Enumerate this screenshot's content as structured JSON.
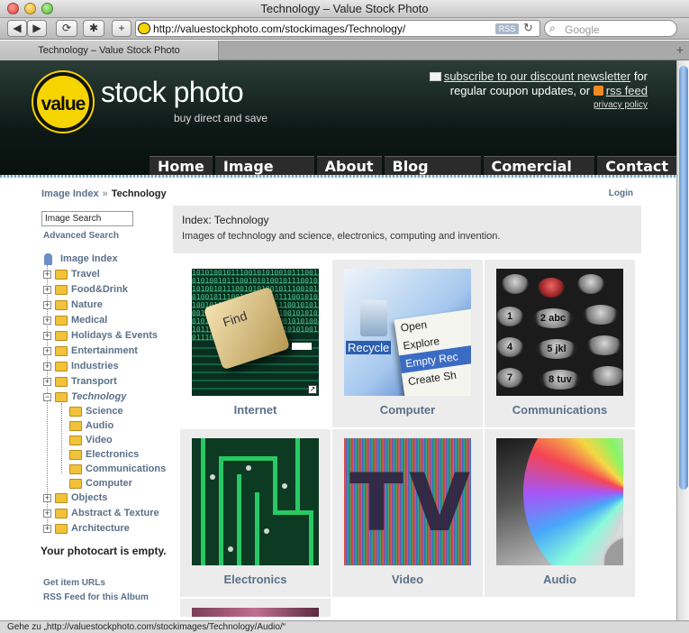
{
  "window": {
    "title": "Technology – Value Stock Photo"
  },
  "toolbar": {
    "url": "http://valuestockphoto.com/stockimages/Technology/",
    "rss_badge": "RSS",
    "search_placeholder": "Google",
    "back_glyph": "◀",
    "forward_glyph": "▶",
    "add_glyph": "+"
  },
  "tab": {
    "label": "Technology – Value Stock Photo"
  },
  "site": {
    "logo_badge": "value",
    "logo_name": "stock photo",
    "tagline": "buy direct and save",
    "newsletter_link": "subscribe to our discount newsletter",
    "newsletter_for": "for",
    "coupon_text": "regular coupon updates, or",
    "rss_link": "rss feed",
    "privacy": "privacy policy",
    "nav": [
      "Home",
      "Image Index",
      "About",
      "Blog Photos",
      "Comercial Use",
      "Contact"
    ]
  },
  "breadcrumb": {
    "parent": "Image Index",
    "sep": "»",
    "current": "Technology"
  },
  "login": "Login",
  "sidebar": {
    "search_value": "Image Search",
    "advanced": "Advanced Search",
    "root": "Image Index",
    "categories": [
      "Travel",
      "Food&Drink",
      "Nature",
      "Medical",
      "Holidays & Events",
      "Entertainment",
      "Industries",
      "Transport"
    ],
    "active": "Technology",
    "subcategories": [
      "Science",
      "Audio",
      "Video",
      "Electronics",
      "Communications",
      "Computer"
    ],
    "after": [
      "Objects",
      "Abstract & Texture",
      "Architecture"
    ],
    "cart": "Your photocart is empty.",
    "item_urls": "Get item URLs",
    "rss_album": "RSS Feed for this Album"
  },
  "index": {
    "title": "Index: Technology",
    "description": "Images of technology and science, electronics, computing and invention."
  },
  "thumbs": [
    "Internet",
    "Computer",
    "Communications",
    "Electronics",
    "Video",
    "Audio"
  ],
  "thumb_text": {
    "key": "Find",
    "menu": [
      "Open",
      "Explore",
      "Empty Rec",
      "Create Sh"
    ],
    "recycle": "Recycle",
    "keys": [
      "1",
      "2 abc",
      "4",
      "5 jkl",
      "7",
      "8 tuv"
    ],
    "tv": "TV",
    "digits": "1010100101110010101001011100101010010111001010100101110010101001011100101010010111001010100101110010101001011100101010010111001010100101110010101001011100101010010111001010100101110010101001011100101010010111001010100101110010101001011100"
  },
  "status": "Gehe zu „http://valuestockphoto.com/stockimages/Technology/Audio/“",
  "colors": {
    "link": "#5b708a",
    "header_dark": "#0d1815",
    "logo_yellow": "#f6d400"
  }
}
